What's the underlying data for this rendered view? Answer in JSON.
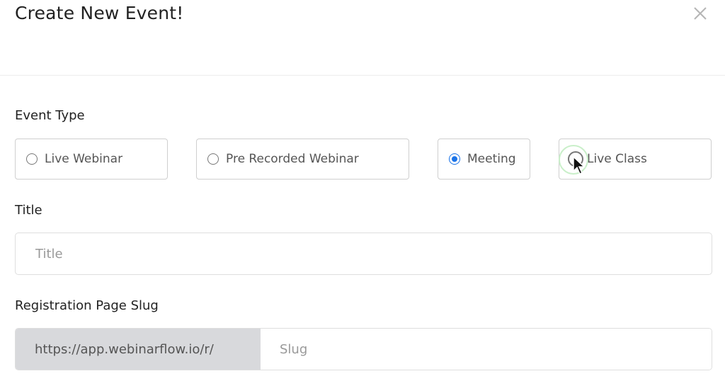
{
  "modal": {
    "title": "Create New Event!",
    "close_icon": "close-icon"
  },
  "event_type": {
    "label": "Event Type",
    "options": [
      {
        "label": "Live Webinar",
        "checked": false
      },
      {
        "label": "Pre Recorded Webinar",
        "checked": false
      },
      {
        "label": "Meeting",
        "checked": true
      },
      {
        "label": "Live Class",
        "checked": false
      }
    ],
    "accent_color": "#1a73e8"
  },
  "title_field": {
    "label": "Title",
    "value": "",
    "placeholder": "Title"
  },
  "slug_field": {
    "label": "Registration Page Slug",
    "prefix": "https://app.webinarflow.io/r/",
    "value": "",
    "placeholder": "Slug"
  }
}
